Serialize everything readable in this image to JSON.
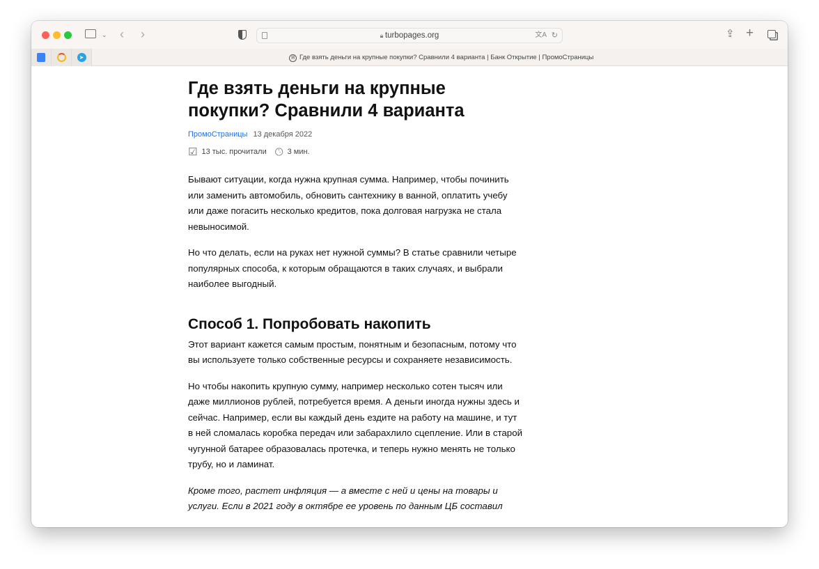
{
  "browser": {
    "url": "turbopages.org",
    "tab_title": "Где взять деньги на крупные покупки? Сравнили 4 варианта | Банк Открытие | ПромоСтраницы",
    "colors": {
      "close": "#ff5f57",
      "minimize": "#febc2e",
      "zoom": "#28c840"
    }
  },
  "article": {
    "title": "Где взять деньги на крупные покупки? Сравнили 4 варианта",
    "source": "ПромоСтраницы",
    "date": "13 декабря 2022",
    "reads": "13 тыс. прочитали",
    "read_time": "3 мин.",
    "p1": "Бывают ситуации, когда нужна крупная сумма. Например, чтобы починить или заменить автомобиль, обновить сантехнику в ванной, оплатить учебу или даже погасить несколько кредитов, пока долговая нагрузка не стала невыносимой.",
    "p2": "Но что делать, если на руках нет нужной суммы? В статье сравнили четыре популярных способа, к которым обращаются в таких случаях, и выбрали наиболее выгодный.",
    "h2": "Способ 1. Попробовать накопить",
    "p3": "Этот вариант кажется самым простым, понятным и безопасным, потому что вы используете только собственные ресурсы и сохраняете независимость.",
    "p4": "Но чтобы накопить крупную сумму, например несколько сотен тысяч или даже миллионов рублей, потребуется время. А деньги иногда нужны здесь и сейчас. Например, если вы каждый день ездите на работу на машине, и тут в ней сломалась коробка передач или забарахлило сцепление. Или в старой чугунной батарее образовалась протечка, и теперь нужно менять не только трубу, но и ламинат.",
    "p5": "Кроме того, растет инфляция — а вместе с ней и цены на товары и услуги. Если в 2021 году в октябре ее уровень по данным ЦБ составил"
  }
}
